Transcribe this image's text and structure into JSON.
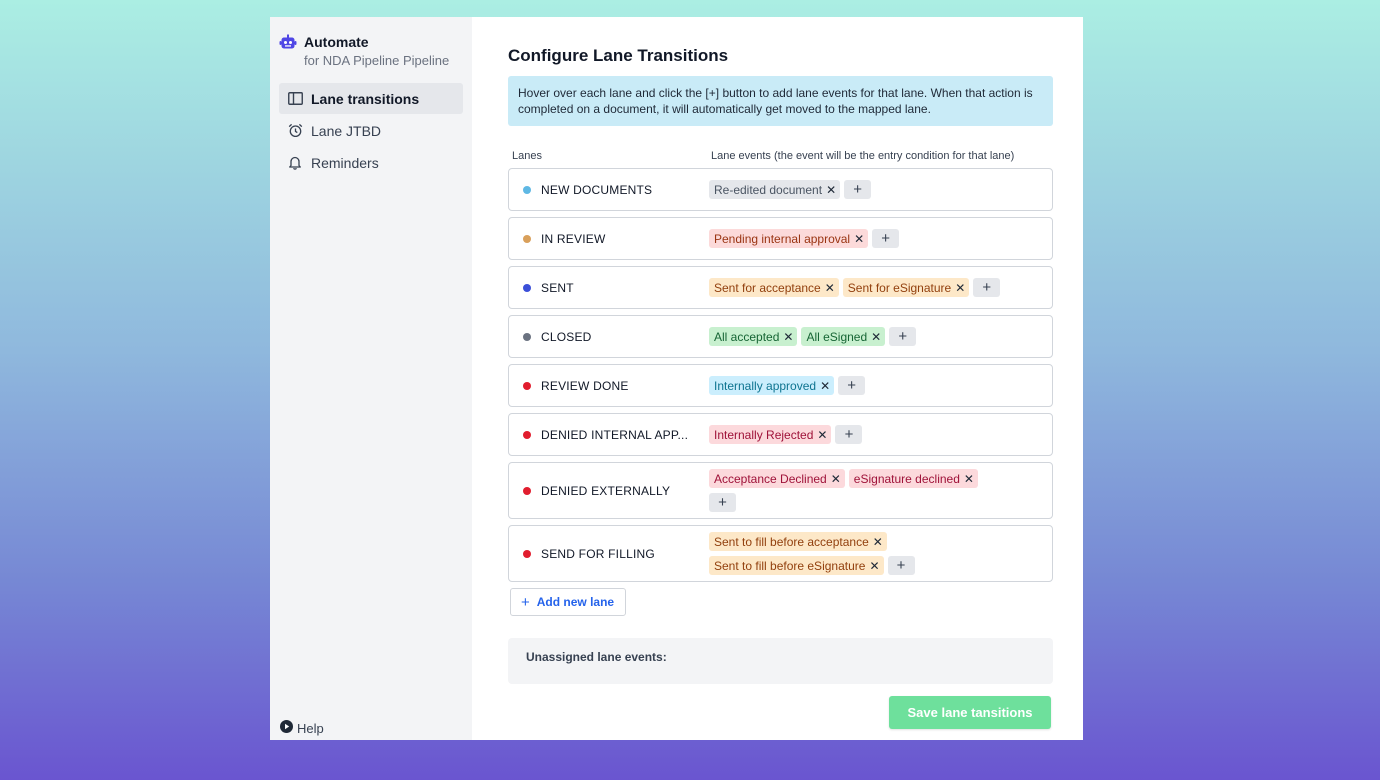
{
  "sidebar": {
    "brand_title": "Automate",
    "brand_subtitle": "for NDA Pipeline Pipeline",
    "items": [
      {
        "label": "Lane transitions",
        "icon": "columns-icon",
        "active": true
      },
      {
        "label": "Lane JTBD",
        "icon": "alarm-clock-icon",
        "active": false
      },
      {
        "label": "Reminders",
        "icon": "bell-icon",
        "active": false
      }
    ],
    "help_label": "Help"
  },
  "main": {
    "title": "Configure Lane Transitions",
    "info": "Hover over each lane and click the [+] button to add lane events for that lane. When that action is completed on a document, it will automatically get moved to the mapped lane.",
    "col_lanes": "Lanes",
    "col_events": "Lane events (the event will be the entry condition for that lane)",
    "lanes": [
      {
        "name": "NEW DOCUMENTS",
        "dot": "#5fb8e4",
        "events": [
          {
            "label": "Re-edited document",
            "style": "t-gray"
          }
        ]
      },
      {
        "name": "IN REVIEW",
        "dot": "#d9a05b",
        "events": [
          {
            "label": "Pending internal approval",
            "style": "t-red"
          }
        ]
      },
      {
        "name": "SENT",
        "dot": "#3b4fd8",
        "events": [
          {
            "label": "Sent for acceptance",
            "style": "t-orange"
          },
          {
            "label": "Sent for eSignature",
            "style": "t-orange"
          }
        ]
      },
      {
        "name": "CLOSED",
        "dot": "#6b7280",
        "events": [
          {
            "label": "All accepted",
            "style": "t-green"
          },
          {
            "label": "All eSigned",
            "style": "t-green"
          }
        ]
      },
      {
        "name": "REVIEW DONE",
        "dot": "#e11d2e",
        "events": [
          {
            "label": "Internally approved",
            "style": "t-blue"
          }
        ]
      },
      {
        "name": "DENIED INTERNAL APP...",
        "dot": "#e11d2e",
        "events": [
          {
            "label": "Internally Rejected",
            "style": "t-pink"
          }
        ]
      },
      {
        "name": "DENIED EXTERNALLY",
        "dot": "#e11d2e",
        "events": [
          {
            "label": "Acceptance Declined",
            "style": "t-pink"
          },
          {
            "label": "eSignature declined",
            "style": "t-pink"
          }
        ]
      },
      {
        "name": "SEND FOR FILLING",
        "dot": "#e11d2e",
        "events": [
          {
            "label": "Sent to fill before acceptance",
            "style": "t-orange"
          },
          {
            "label": "Sent to fill before eSignature",
            "style": "t-orange"
          }
        ]
      }
    ],
    "add_lane_label": "Add new lane",
    "unassigned_label": "Unassigned lane events:",
    "save_label": "Save lane tansitions"
  }
}
